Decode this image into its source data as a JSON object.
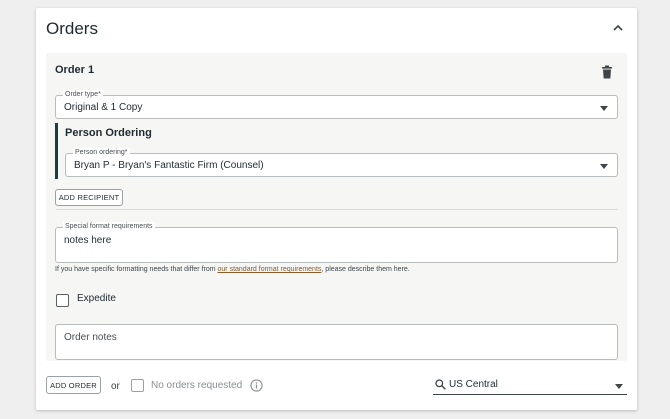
{
  "card": {
    "title": "Orders"
  },
  "order": {
    "title": "Order 1",
    "order_type": {
      "label": "Order type*",
      "value": "Original & 1 Copy"
    },
    "person_section": {
      "title": "Person Ordering",
      "field": {
        "label": "Person ordering*",
        "value": "Bryan P - Bryan's Fantastic Firm (Counsel)"
      }
    },
    "add_recipient_label": "ADD RECIPIENT",
    "special_format": {
      "label": "Special format requirements",
      "value": "notes here"
    },
    "helper": {
      "before": "If you have specific formatting needs that differ from ",
      "link": "our standard format requirements",
      "after": ", please describe them here."
    },
    "expedite_label": "Expedite",
    "order_notes_placeholder": "Order notes"
  },
  "footer": {
    "add_order_label": "ADD ORDER",
    "or_text": "or",
    "no_orders_label": "No orders requested",
    "timezone_value": "US Central"
  }
}
